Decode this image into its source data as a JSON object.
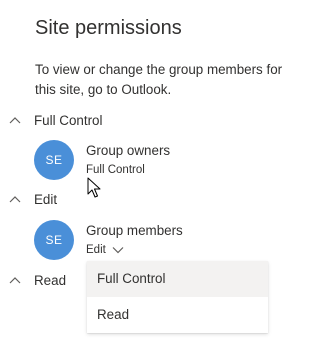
{
  "panel": {
    "title": "Site permissions",
    "description": "To view or change the group members for this site, go to Outlook."
  },
  "sections": {
    "full_control": {
      "label": "Full Control",
      "chevron": "chevron-up-icon"
    },
    "edit": {
      "label": "Edit",
      "chevron": "chevron-up-icon"
    },
    "read": {
      "label": "Read",
      "chevron": "chevron-up-icon"
    }
  },
  "members": {
    "owners": {
      "initials": "SE",
      "name": "Group owners",
      "role": "Full Control",
      "avatar_color": "#4a8fd8"
    },
    "members": {
      "initials": "SE",
      "name": "Group members",
      "role": "Edit",
      "role_icon": "chevron-down-icon",
      "avatar_color": "#4a8fd8"
    }
  },
  "dropdown": {
    "options": [
      "Full Control",
      "Read"
    ],
    "hovered": "Full Control"
  },
  "colors": {
    "text": "#323130",
    "avatar": "#4a8fd8",
    "hover": "#f3f2f1"
  }
}
